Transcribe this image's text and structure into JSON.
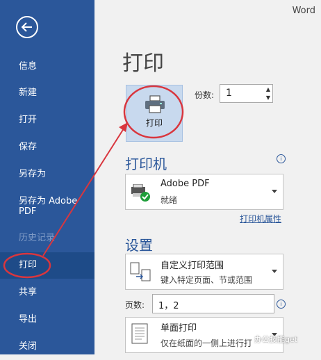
{
  "window": {
    "app_name": "Word"
  },
  "sidebar": {
    "back_icon": "arrow-left-icon",
    "items": [
      {
        "label": "信息",
        "state": "normal"
      },
      {
        "label": "新建",
        "state": "normal"
      },
      {
        "label": "打开",
        "state": "normal"
      },
      {
        "label": "保存",
        "state": "normal"
      },
      {
        "label": "另存为",
        "state": "normal"
      },
      {
        "label": "另存为 Adobe\nPDF",
        "state": "normal"
      },
      {
        "label": "历史记录",
        "state": "disabled"
      },
      {
        "label": "打印",
        "state": "active"
      },
      {
        "label": "共享",
        "state": "normal"
      },
      {
        "label": "导出",
        "state": "normal"
      },
      {
        "label": "关闭",
        "state": "normal"
      }
    ]
  },
  "main": {
    "title": "打印",
    "print_button": {
      "label": "打印",
      "icon": "printer-icon"
    },
    "copies": {
      "label": "份数:",
      "value": "1"
    },
    "printer_section": {
      "title": "打印机",
      "name": "Adobe PDF",
      "status": "就绪",
      "icon": "printer-ready-icon",
      "properties_link": "打印机属性"
    },
    "settings_section": {
      "title": "设置",
      "range": {
        "title": "自定义打印范围",
        "desc": "键入特定页面、节或范围",
        "icon": "page-range-icon"
      },
      "pages": {
        "label": "页数:",
        "value": "1，2"
      },
      "sides": {
        "title": "单面打印",
        "desc": "仅在纸面的一侧上进行打",
        "icon": "single-sided-icon"
      }
    }
  },
  "watermark": "办公技能get",
  "colors": {
    "sidebar": "#2b579a",
    "active_item": "#1e4b88",
    "annotation": "#d9363e"
  }
}
